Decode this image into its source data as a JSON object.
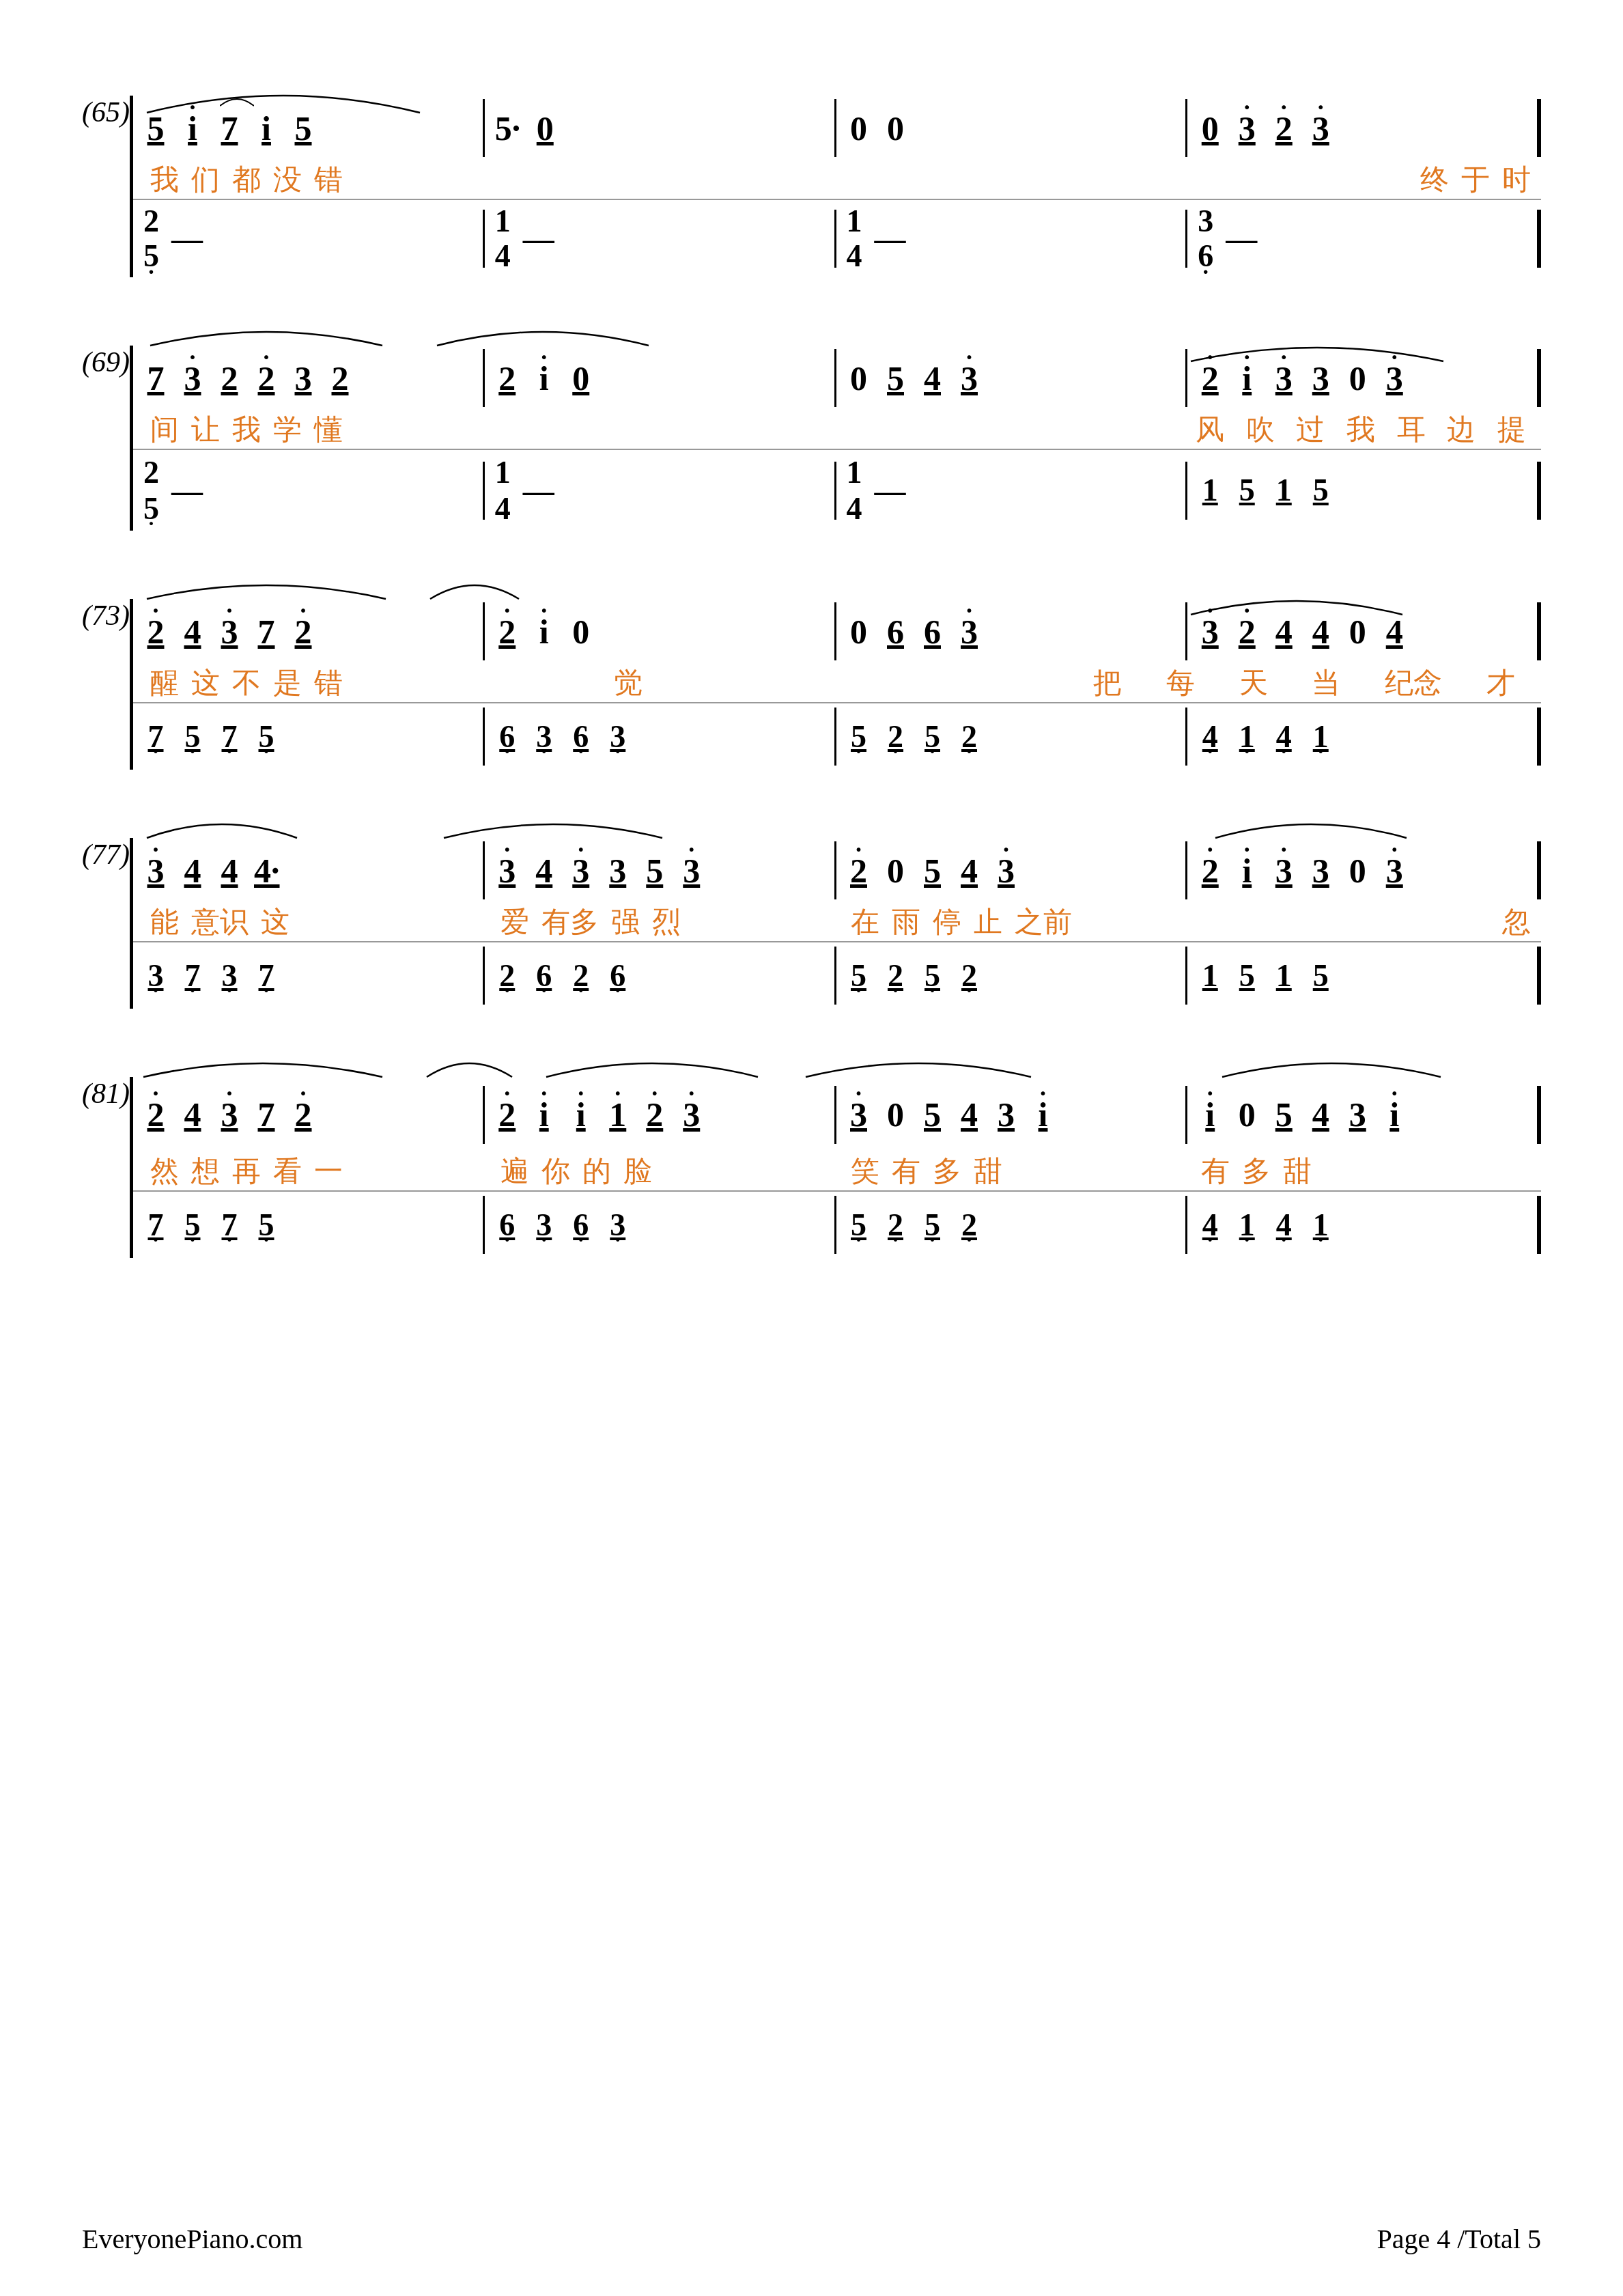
{
  "page": {
    "footer": {
      "left": "EveryonePiano.com",
      "right": "Page 4 /Total 5"
    },
    "sections": [
      {
        "id": "s65",
        "measure_start": "(65)",
        "treble": [
          {
            "notes": [
              "5",
              "i",
              "7",
              "7̄",
              "i",
              "5",
              "5·",
              "0"
            ],
            "raw": "5 i7 7i 5 5· 0",
            "lyrics": [
              "我",
              "们",
              "都",
              "没",
              "错",
              "",
              "",
              ""
            ]
          }
        ]
      }
    ]
  }
}
